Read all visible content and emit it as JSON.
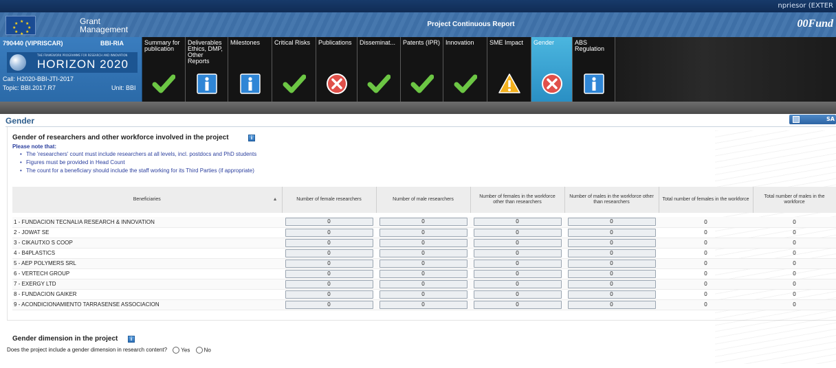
{
  "user": {
    "name": "npriesor (EXTER"
  },
  "header": {
    "brand_line1": "Grant",
    "brand_line2": "Management",
    "report_title": "Project Continuous Report",
    "fund_logo": "00Fund"
  },
  "project": {
    "code": "790440 (VIPRISCAR)",
    "type": "BBI-RIA",
    "programme_small": "THE FRAMEWORK PROGRAMME FOR RESEARCH AND INNOVATION",
    "programme": "HORIZON 2020",
    "call": "Call: H2020-BBI-JTI-2017",
    "topic": "Topic: BBI.2017.R7",
    "unit": "Unit: BBI"
  },
  "tabs": [
    {
      "label": "Summary for\npublication",
      "status": "ok"
    },
    {
      "label": "Deliverables\nEthics, DMP,\nOther\nReports",
      "status": "info"
    },
    {
      "label": "Milestones",
      "status": "info"
    },
    {
      "label": "Critical Risks",
      "status": "ok"
    },
    {
      "label": "Publications",
      "status": "error"
    },
    {
      "label": "Disseminat...",
      "status": "ok"
    },
    {
      "label": "Patents (IPR)",
      "status": "ok"
    },
    {
      "label": "Innovation",
      "status": "ok"
    },
    {
      "label": "SME Impact",
      "status": "warning"
    },
    {
      "label": "Gender",
      "status": "error",
      "active": true
    },
    {
      "label": "ABS\nRegulation",
      "status": "info"
    }
  ],
  "page": {
    "title": "Gender",
    "save_label": "SA"
  },
  "workforce": {
    "title": "Gender of researchers and other workforce involved in the project",
    "note_head": "Please note that:",
    "notes": [
      "The 'researchers' count must include researchers at all levels, incl. postdocs and PhD students",
      "Figures must be provided in Head Count",
      "The count for a beneficiary should include the staff working for its Third Parties (if appropriate)"
    ],
    "columns": [
      "Beneficiaries",
      "Number of female researchers",
      "Number of male researchers",
      "Number of females in the workforce other than researchers",
      "Number of males in the workforce other than researchers",
      "Total number of females in the workforce",
      "Total number of males in the workforce"
    ],
    "rows": [
      {
        "name": "1 - FUNDACION TECNALIA RESEARCH & INNOVATION",
        "female_res": "0",
        "male_res": "0",
        "female_other": "0",
        "male_other": "0",
        "total_female": "0",
        "total_male": "0"
      },
      {
        "name": "2 - JOWAT SE",
        "female_res": "0",
        "male_res": "0",
        "female_other": "0",
        "male_other": "0",
        "total_female": "0",
        "total_male": "0"
      },
      {
        "name": "3 - CIKAUTXO S COOP",
        "female_res": "0",
        "male_res": "0",
        "female_other": "0",
        "male_other": "0",
        "total_female": "0",
        "total_male": "0"
      },
      {
        "name": "4 - B4PLASTICS",
        "female_res": "0",
        "male_res": "0",
        "female_other": "0",
        "male_other": "0",
        "total_female": "0",
        "total_male": "0"
      },
      {
        "name": "5 - AEP POLYMERS SRL",
        "female_res": "0",
        "male_res": "0",
        "female_other": "0",
        "male_other": "0",
        "total_female": "0",
        "total_male": "0"
      },
      {
        "name": "6 - VERTECH GROUP",
        "female_res": "0",
        "male_res": "0",
        "female_other": "0",
        "male_other": "0",
        "total_female": "0",
        "total_male": "0"
      },
      {
        "name": "7 - EXERGY LTD",
        "female_res": "0",
        "male_res": "0",
        "female_other": "0",
        "male_other": "0",
        "total_female": "0",
        "total_male": "0"
      },
      {
        "name": "8 - FUNDACION GAIKER",
        "female_res": "0",
        "male_res": "0",
        "female_other": "0",
        "male_other": "0",
        "total_female": "0",
        "total_male": "0"
      },
      {
        "name": "9 - ACONDICIONAMIENTO TARRASENSE ASSOCIACION",
        "female_res": "0",
        "male_res": "0",
        "female_other": "0",
        "male_other": "0",
        "total_female": "0",
        "total_male": "0"
      }
    ]
  },
  "dimension": {
    "title": "Gender dimension in the project",
    "question": "Does the project include a gender dimension in research content?",
    "yes_label": "Yes",
    "no_label": "No"
  },
  "colors": {
    "ok": "#6cc644",
    "info": "#2f86d6",
    "error": "#e0504a",
    "warning": "#f2b01e",
    "active_tab": "#3aa6d6"
  }
}
